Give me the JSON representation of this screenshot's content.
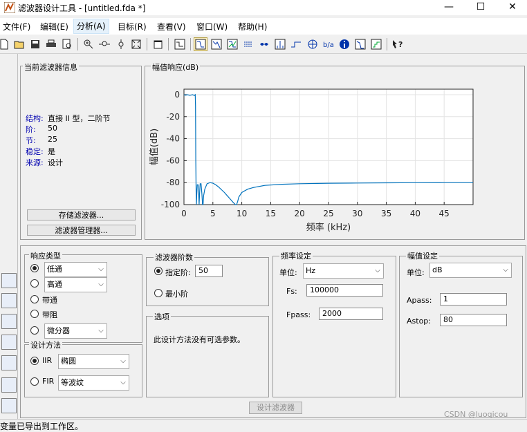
{
  "window": {
    "title": "滤波器设计工具 -  [untitled.fda *]",
    "minimize": "—",
    "maximize": "☐",
    "close": "✕"
  },
  "menu": [
    "文件(F)",
    "编辑(E)",
    "分析(A)",
    "目标(R)",
    "查看(V)",
    "窗口(W)",
    "帮助(H)"
  ],
  "active_menu": "分析(A)",
  "toolbar_icons": [
    "new-icon",
    "open-icon",
    "save-icon",
    "print-icon",
    "print-preview-icon",
    "zoom-in-icon",
    "zoom-x-icon",
    "zoom-y-icon",
    "full-view-icon",
    "new-window-icon",
    "filter-specs-icon",
    "magnitude-response-icon",
    "phase-response-icon",
    "magnitude-phase-icon",
    "group-delay-icon",
    "phase-delay-icon",
    "impulse-response-icon",
    "step-response-icon",
    "pole-zero-icon",
    "filter-coefficients-icon",
    "filter-info-icon",
    "magnitude-estimate-icon",
    "round-off-noise-icon",
    "whats-this-icon"
  ],
  "current_filter": {
    "label": "当前滤波器信息",
    "rows": [
      {
        "k": "结构:",
        "v": "直接 II 型，二阶节"
      },
      {
        "k": "阶:",
        "v": "50"
      },
      {
        "k": "节:",
        "v": "25"
      },
      {
        "k": "稳定:",
        "v": "是"
      },
      {
        "k": "来源:",
        "v": "设计"
      }
    ],
    "store_btn": "存储滤波器...",
    "manager_btn": "滤波器管理器..."
  },
  "plot_panel_label": "幅值响应(dB)",
  "chart_data": {
    "type": "line",
    "title": "",
    "xlabel": "频率 (kHz)",
    "ylabel": "幅值(dB)",
    "xlim": [
      0,
      50
    ],
    "ylim": [
      -100,
      5
    ],
    "xticks": [
      0,
      5,
      10,
      15,
      20,
      25,
      30,
      35,
      40,
      45
    ],
    "yticks": [
      0,
      -20,
      -40,
      -60,
      -80,
      -100
    ],
    "grid": true,
    "color": "#0072bd",
    "x": [
      0,
      0.3,
      0.6,
      1.0,
      1.5,
      1.8,
      1.95,
      2.0,
      2.02,
      2.05,
      2.1,
      2.15,
      2.2,
      2.3,
      2.45,
      2.55,
      2.62,
      2.7,
      2.8,
      2.95,
      3.1,
      3.2,
      3.3,
      3.4,
      3.6,
      4.0,
      4.5,
      5.0,
      5.5,
      6.0,
      6.5,
      7.0,
      7.5,
      8.0,
      8.5,
      8.9,
      9.1,
      9.3,
      9.5,
      10.0,
      11.0,
      12.0,
      14.0,
      17.0,
      20.0,
      25.0,
      30.0,
      35.0,
      40.0,
      45.0,
      50.0
    ],
    "y": [
      0,
      -0.5,
      0,
      -0.6,
      0,
      -0.8,
      0,
      -10,
      -30,
      -60,
      -90,
      -100,
      -92,
      -82,
      -82,
      -90,
      -100,
      -90,
      -81,
      -81,
      -90,
      -100,
      -100,
      -92,
      -86,
      -81,
      -80,
      -80.5,
      -82,
      -84,
      -86.5,
      -89,
      -92,
      -95,
      -98,
      -100,
      -100,
      -97,
      -93,
      -89,
      -86,
      -84.5,
      -82.5,
      -81.5,
      -81,
      -80.6,
      -80.4,
      -80.2,
      -80.1,
      -80,
      -80
    ]
  },
  "response_type": {
    "label": "响应类型",
    "options": [
      {
        "label": "低通",
        "combo": "低通",
        "checked": true
      },
      {
        "label": "高通",
        "combo": "高通",
        "checked": false
      },
      {
        "label": "带通",
        "combo": "",
        "checked": false
      },
      {
        "label": "带阻",
        "combo": "",
        "checked": false
      },
      {
        "label": "微分器",
        "combo": "微分器",
        "checked": false
      }
    ]
  },
  "design_method": {
    "label": "设计方法",
    "iir": {
      "label": "IIR",
      "value": "椭圆",
      "checked": true
    },
    "fir": {
      "label": "FIR",
      "value": "等波纹",
      "checked": false
    }
  },
  "filter_order": {
    "label": "滤波器阶数",
    "specify": {
      "label": "指定阶:",
      "value": "50",
      "checked": true
    },
    "minimum": {
      "label": "最小阶",
      "checked": false
    }
  },
  "options": {
    "label": "选项",
    "text": "此设计方法没有可选参数。"
  },
  "freq_spec": {
    "label": "频率设定",
    "units_label": "单位:",
    "units": "Hz",
    "fs_label": "Fs:",
    "fs": "100000",
    "fpass_label": "Fpass:",
    "fpass": "2000"
  },
  "mag_spec": {
    "label": "幅值设定",
    "units_label": "单位:",
    "units": "dB",
    "apass_label": "Apass:",
    "apass": "1",
    "astop_label": "Astop:",
    "astop": "80"
  },
  "design_button": "设计滤波器",
  "side_icons": [
    "transform-filter-icon",
    "create-multirate-icon",
    "realize-model-icon",
    "pole-zero-editor-icon",
    "import-filter-icon",
    "design-filter-icon",
    "export-icon",
    "filter-design-icon"
  ],
  "status_text": "变量已导出到工作区。",
  "watermark": "CSDN @luoqicou"
}
